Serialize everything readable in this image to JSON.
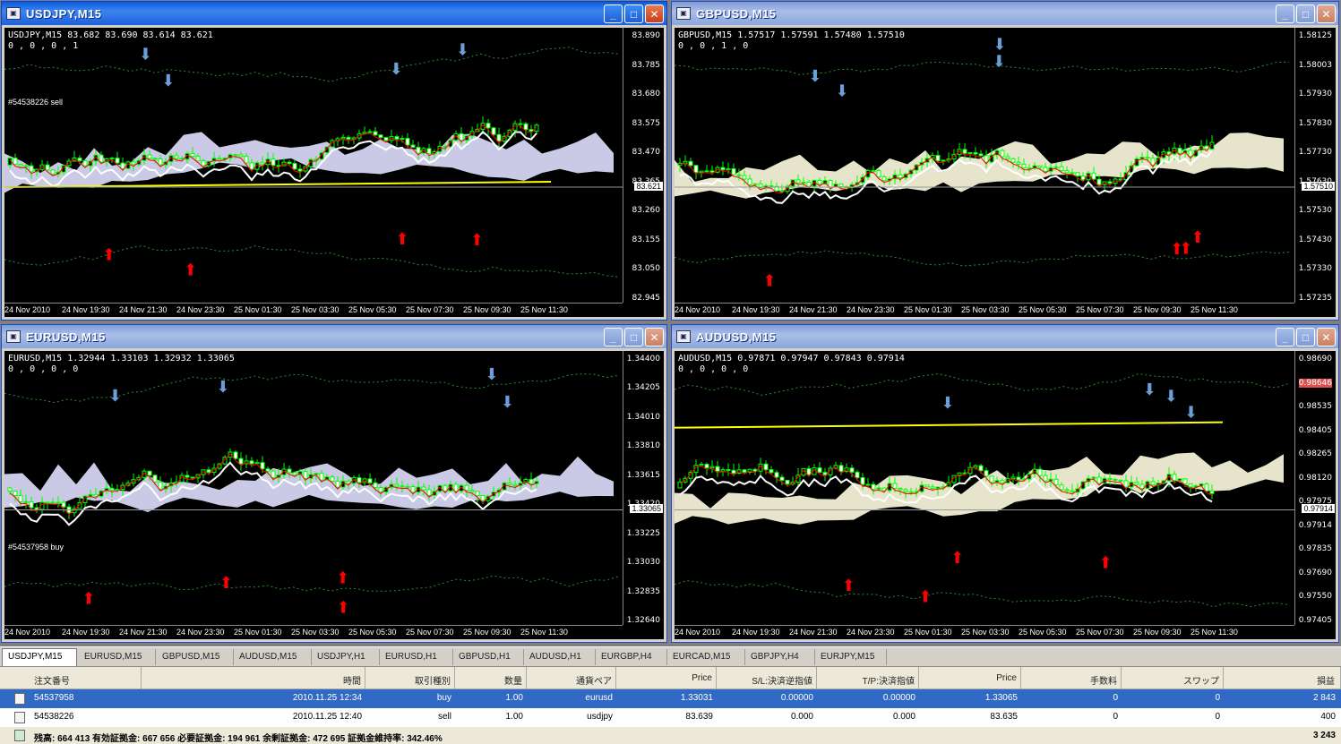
{
  "windows": [
    {
      "id": "usdjpy",
      "title": "USDJPY,M15",
      "header_line1": "USDJPY,M15  83.682 83.690 83.614 83.621",
      "header_line2": "0 , 0 , 0 , 1",
      "prices": [
        "83.890",
        "83.785",
        "83.680",
        "83.575",
        "83.470",
        "83.365",
        "83.260",
        "83.155",
        "83.050",
        "82.945"
      ],
      "current_price": "83.621",
      "times": [
        "24 Nov 2010",
        "24 Nov 19:30",
        "24 Nov 21:30",
        "24 Nov 23:30",
        "25 Nov 01:30",
        "25 Nov 03:30",
        "25 Nov 05:30",
        "25 Nov 07:30",
        "25 Nov 09:30",
        "25 Nov 11:30"
      ],
      "order_label": "#54538226 sell"
    },
    {
      "id": "gbpusd",
      "title": "GBPUSD,M15",
      "header_line1": "GBPUSD,M15  1.57517 1.57591 1.57480 1.57510",
      "header_line2": "0 , 0 , 1 , 0",
      "prices": [
        "1.58125",
        "1.58003",
        "1.57930",
        "1.57830",
        "1.57730",
        "1.57630",
        "1.57530",
        "1.57430",
        "1.57330",
        "1.57235"
      ],
      "current_price": "1.57510",
      "times": [
        "24 Nov 2010",
        "24 Nov 19:30",
        "24 Nov 21:30",
        "24 Nov 23:30",
        "25 Nov 01:30",
        "25 Nov 03:30",
        "25 Nov 05:30",
        "25 Nov 07:30",
        "25 Nov 09:30",
        "25 Nov 11:30"
      ],
      "order_label": ""
    },
    {
      "id": "eurusd",
      "title": "EURUSD,M15",
      "header_line1": "EURUSD,M15  1.32944 1.33103 1.32932 1.33065",
      "header_line2": "0 , 0 , 0 , 0",
      "prices": [
        "1.34400",
        "1.34205",
        "1.34010",
        "1.33810",
        "1.33615",
        "1.33420",
        "1.33225",
        "1.33030",
        "1.32835",
        "1.32640"
      ],
      "current_price": "1.33065",
      "times": [
        "24 Nov 2010",
        "24 Nov 19:30",
        "24 Nov 21:30",
        "24 Nov 23:30",
        "25 Nov 01:30",
        "25 Nov 03:30",
        "25 Nov 05:30",
        "25 Nov 07:30",
        "25 Nov 09:30",
        "25 Nov 11:30"
      ],
      "order_label": "#54537958 buy"
    },
    {
      "id": "audusd",
      "title": "AUDUSD,M15",
      "header_line1": "AUDUSD,M15  0.97871 0.97947 0.97843 0.97914",
      "header_line2": "0 , 0 , 0 , 0",
      "prices": [
        "0.98690",
        "0.98646",
        "0.98535",
        "0.98405",
        "0.98265",
        "0.98120",
        "0.97975",
        "0.97914",
        "0.97835",
        "0.97690",
        "0.97550",
        "0.97405"
      ],
      "current_price": "0.97914",
      "alert_price": "0.98646",
      "times": [
        "24 Nov 2010",
        "24 Nov 19:30",
        "24 Nov 21:30",
        "24 Nov 23:30",
        "25 Nov 01:30",
        "25 Nov 03:30",
        "25 Nov 05:30",
        "25 Nov 07:30",
        "25 Nov 09:30",
        "25 Nov 11:30"
      ],
      "order_label": ""
    }
  ],
  "chart_tabs": [
    "USDJPY,M15",
    "EURUSD,M15",
    "GBPUSD,M15",
    "AUDUSD,M15",
    "USDJPY,H1",
    "EURUSD,H1",
    "GBPUSD,H1",
    "AUDUSD,H1",
    "EURGBP,H4",
    "EURCAD,M15",
    "GBPJPY,H4",
    "EURJPY,M15"
  ],
  "terminal": {
    "columns": [
      "注文番号",
      "時間",
      "取引種別",
      "数量",
      "通貨ペア",
      "Price",
      "S/L:決済逆指値",
      "T/P:決済指値",
      "Price",
      "手数料",
      "スワップ",
      "損益"
    ],
    "rows": [
      [
        "54537958",
        "2010.11.25 12:34",
        "buy",
        "1.00",
        "eurusd",
        "1.33031",
        "0.00000",
        "0.00000",
        "1.33065",
        "0",
        "0",
        "2 843"
      ],
      [
        "54538226",
        "2010.11.25 12:40",
        "sell",
        "1.00",
        "usdjpy",
        "83.639",
        "0.000",
        "0.000",
        "83.635",
        "0",
        "0",
        "400"
      ]
    ],
    "footer": "残高: 664 413  有効証拠金: 667 656  必要証拠金: 194 961  余剰証拠金: 472 695  証拠金維持率: 342.46%",
    "footer_total": "3 243"
  },
  "colors": {
    "candle_up": "#00ff00",
    "ma_red": "#ff0000",
    "yellow_line": "#ffff00",
    "cloud_blue": "#e0e0ff",
    "cloud_beige": "#fffde0",
    "arrow_up": "#ff0000",
    "arrow_down": "#6c9fd8"
  }
}
